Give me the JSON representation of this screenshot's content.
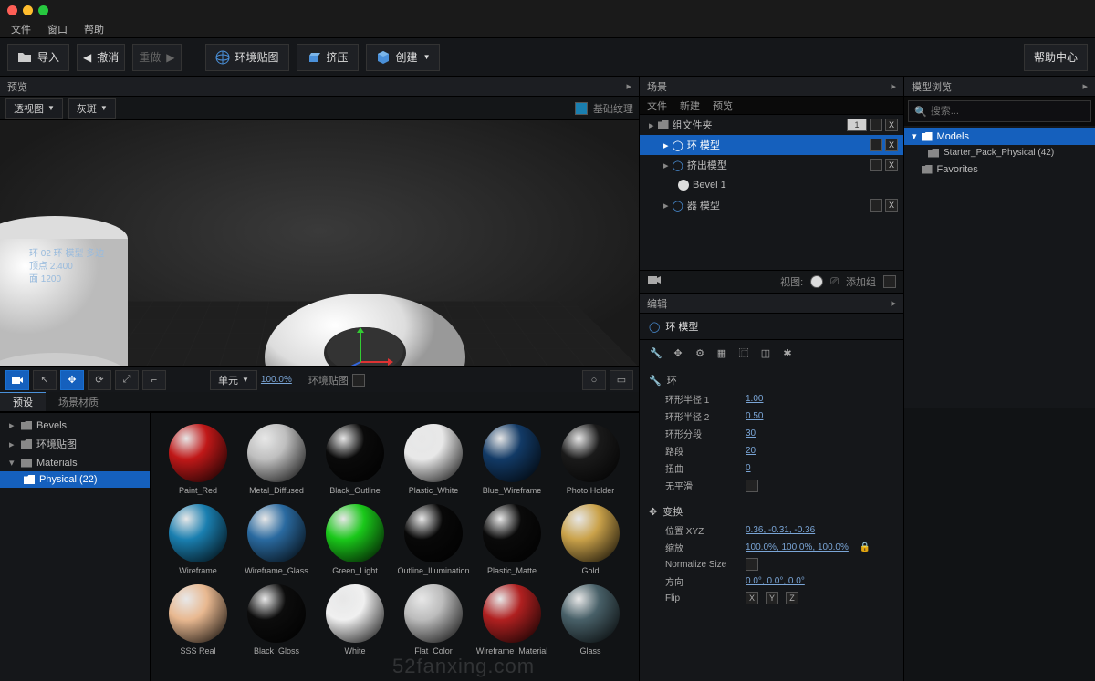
{
  "menu": {
    "file": "文件",
    "window": "窗口",
    "help": "帮助"
  },
  "toolbar": {
    "import": "导入",
    "undo": "撤消",
    "redo": "重做",
    "envmap": "环境贴图",
    "extrude": "挤压",
    "create": "创建",
    "help_center": "帮助中心"
  },
  "viewport_panel": {
    "header": "预览",
    "dd_view": "透视图",
    "dd_shade": "灰斑",
    "right_label": "基础纹理",
    "stats": {
      "l1": "环 02 环 模型 多边",
      "l2": "顶点  2.400",
      "l3": "面  1200"
    },
    "vp_units": "单元",
    "vp_zoom": "100.0%",
    "vp_env": "环境贴图"
  },
  "material_panel": {
    "tab_presets": "预设",
    "tab_scene_mat": "场景材质",
    "tree": {
      "bevels": "Bevels",
      "envmaps": "环境贴图",
      "materials": "Materials",
      "physical": "Physical (22)"
    },
    "mats": [
      {
        "name": "Paint_Red",
        "c": "#c01818"
      },
      {
        "name": "Metal_Diffused",
        "c": "#bfbfbf"
      },
      {
        "name": "Black_Outline",
        "c": "#0a0a0a"
      },
      {
        "name": "Plastic_White",
        "c": "#e8e8e8"
      },
      {
        "name": "Blue_Wireframe",
        "c": "#123a66"
      },
      {
        "name": "Photo Holder",
        "c": "#1a1a1a"
      },
      {
        "name": "Wireframe",
        "c": "#1a7fb0"
      },
      {
        "name": "Wireframe_Glass",
        "c": "#2a6aa0"
      },
      {
        "name": "Green_Light",
        "c": "#1ac81a"
      },
      {
        "name": "Outline_Illumination",
        "c": "#080808"
      },
      {
        "name": "Plastic_Matte",
        "c": "#0a0a0a"
      },
      {
        "name": "Gold",
        "c": "#caa24a"
      },
      {
        "name": "SSS Real",
        "c": "#e8b890"
      },
      {
        "name": "Black_Gloss",
        "c": "#0c0c0c"
      },
      {
        "name": "White",
        "c": "#f0f0f0"
      },
      {
        "name": "Flat_Color",
        "c": "#bcbcbc"
      },
      {
        "name": "Wireframe_Material",
        "c": "#b02020"
      },
      {
        "name": "Glass",
        "c": "#486068"
      }
    ]
  },
  "scene": {
    "header": "场景",
    "tb": {
      "file": "文件",
      "new": "新建",
      "preview": "预览"
    },
    "rows": [
      {
        "depth": 0,
        "label": "组文件夹",
        "tag": "1"
      },
      {
        "depth": 1,
        "label": "环 模型",
        "sel": true
      },
      {
        "depth": 1,
        "label": "挤出模型"
      },
      {
        "depth": 2,
        "label": "Bevel 1",
        "plain": true
      },
      {
        "depth": 1,
        "label": "器 模型"
      }
    ],
    "camera": {
      "label": "视图:",
      "add": "添加组"
    }
  },
  "props": {
    "header": "编辑",
    "title": "环 模型",
    "sec_ring": "环",
    "r_radius1": {
      "l": "环形半径 1",
      "v": "1.00"
    },
    "r_radius2": {
      "l": "环形半径 2",
      "v": "0.50"
    },
    "r_seg": {
      "l": "环形分段",
      "v": "30"
    },
    "r_path": {
      "l": "路段",
      "v": "20"
    },
    "r_twist": {
      "l": "扭曲",
      "v": "0"
    },
    "r_smooth": {
      "l": "无平滑",
      "v": ""
    },
    "sec_xform": "变换",
    "x_pos": {
      "l": "位置 XYZ",
      "v": "0.36, -0.31, -0.36"
    },
    "x_scale": {
      "l": "缩放",
      "v": "100.0%, 100.0%, 100.0%"
    },
    "x_norm": {
      "l": "Normalize Size",
      "v": ""
    },
    "x_rot": {
      "l": "方向",
      "v": "0.0°, 0.0°, 0.0°"
    },
    "x_flip": {
      "l": "Flip",
      "v": "X",
      "v2": "Y",
      "v3": "Z"
    }
  },
  "library": {
    "header": "模型浏览",
    "search_ph": "搜索...",
    "models": "Models",
    "starter": "Starter_Pack_Physical (42)",
    "fav": "Favorites"
  },
  "watermark": "52fanxing.com"
}
